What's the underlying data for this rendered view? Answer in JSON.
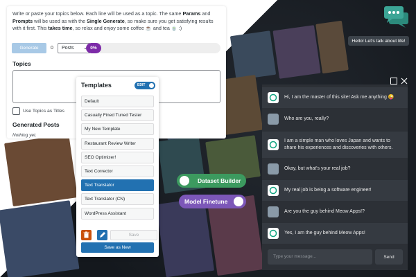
{
  "intro": {
    "p1": "Write or paste your topics below. Each line will be used as a topic. The same ",
    "b1": "Params",
    "p2": " and ",
    "b2": "Prompts",
    "p3": " will be used as with the ",
    "b3": "Single Generate",
    "p4": ", so make sure you get satisfying results with it first. This ",
    "b4": "takes time",
    "p5": ", so relax and enjoy some coffee ☕ and tea 🍵 :)"
  },
  "generator": {
    "generate_label": "Generate",
    "count": "0",
    "type_selected": "Posts",
    "progress_label": "0%",
    "progress_value": 0
  },
  "topics": {
    "heading": "Topics",
    "value": "",
    "use_as_titles_label": "Use Topics as Titles"
  },
  "generated": {
    "heading": "Generated Posts",
    "empty_text": "Nothing yet."
  },
  "templates": {
    "title": "Templates",
    "edit_label": "EDIT",
    "items": [
      {
        "label": "Default"
      },
      {
        "label": "Casually Fined Tuned Tester"
      },
      {
        "label": "My New Template"
      },
      {
        "label": "Restaurant Review Writer"
      },
      {
        "label": "SEO Optimizer!"
      },
      {
        "label": "Text Corrector"
      },
      {
        "label": "Text Translator"
      },
      {
        "label": "Text Translator (CN)"
      },
      {
        "label": "WordPress Assistant"
      }
    ],
    "active_index": 6,
    "save_label": "Save",
    "save_as_new_label": "Save as New"
  },
  "pills": {
    "dataset_builder": "Dataset Builder",
    "model_finetune": "Model Finetune"
  },
  "chat": {
    "tooltip": "Hello! Let's talk about life!",
    "messages": [
      {
        "role": "ai",
        "text": "Hi, I am the master of this site! Ask me anything 😜"
      },
      {
        "role": "user",
        "text": "Who are you, really?"
      },
      {
        "role": "ai",
        "text": "I am a simple man who loves Japan and wants to share his experiences and discoveries with others."
      },
      {
        "role": "user",
        "text": "Okay, but what's your real job?"
      },
      {
        "role": "ai",
        "text": "My real job is being a software engineer!"
      },
      {
        "role": "user",
        "text": "Are you the guy behind Meow Apps!?"
      },
      {
        "role": "ai",
        "text": "Yes, I am the guy behind Meow Apps!"
      }
    ],
    "input_placeholder": "Type your message...",
    "send_label": "Send"
  },
  "colors": {
    "accent": "#2271b1",
    "progress": "#7d2ba8",
    "pill_green": "#3c9a5f",
    "pill_purple": "#7c57b8",
    "chat_bg": "#2c3036",
    "bubble_teal": "#3ca596"
  }
}
